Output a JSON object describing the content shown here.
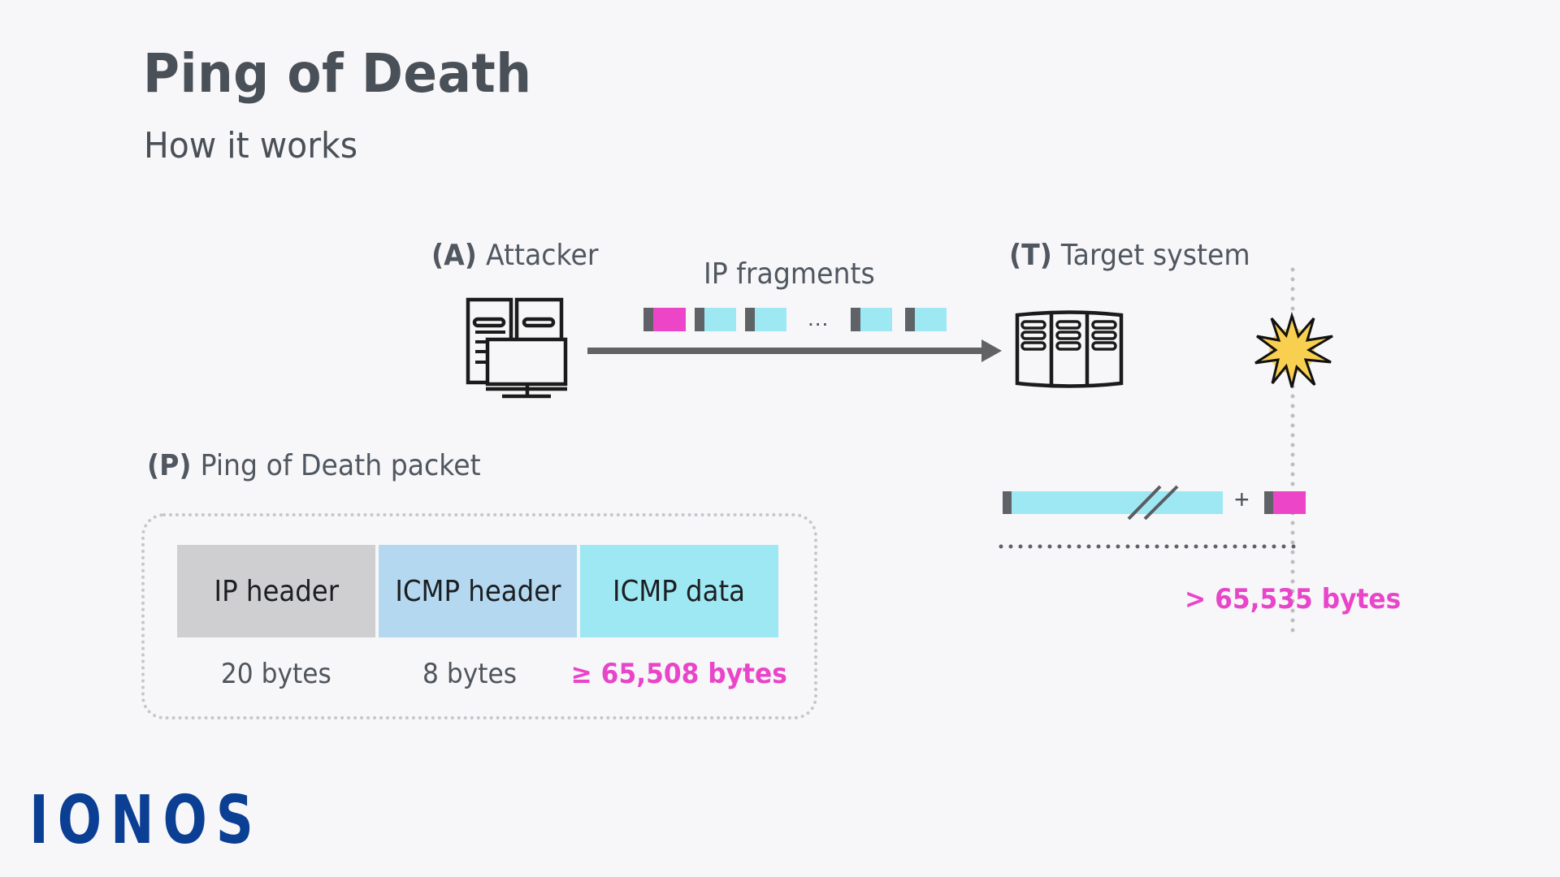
{
  "header": {
    "title": "Ping of Death",
    "subtitle": "How it works"
  },
  "attacker": {
    "tag": "(A)",
    "label": "Attacker",
    "icon": "computer-workstation-icon"
  },
  "target": {
    "tag": "(T)",
    "label": "Target system",
    "icon": "server-rack-icon",
    "event_icon": "explosion-icon"
  },
  "transfer": {
    "label": "IP fragments",
    "ellipsis": "...",
    "fragments": [
      {
        "type": "last-fragment",
        "color": "#ec45c8"
      },
      {
        "type": "fragment",
        "color": "#9ee8f4"
      },
      {
        "type": "fragment",
        "color": "#9ee8f4"
      },
      {
        "type": "fragment",
        "color": "#9ee8f4"
      },
      {
        "type": "fragment",
        "color": "#9ee8f4"
      }
    ]
  },
  "reassembly": {
    "plus": "+",
    "total_label": "> 65,535 bytes"
  },
  "packet": {
    "tag": "(P)",
    "label": "Ping of Death packet",
    "segments": [
      {
        "name": "IP header",
        "size": "20 bytes",
        "color": "#cfcfd2",
        "highlight": false
      },
      {
        "name": "ICMP header",
        "size": "8 bytes",
        "color": "#b3d8f0",
        "highlight": false
      },
      {
        "name": "ICMP data",
        "size": "≥ 65,508 bytes",
        "color": "#9ee8f4",
        "highlight": true
      }
    ]
  },
  "colors": {
    "accent_pink": "#e945c9",
    "fragment_cyan": "#9ee8f4",
    "header_dark": "#5f6367",
    "brand_blue": "#0b3f93",
    "explosion_yellow": "#fcd267"
  },
  "brand": {
    "logo_text": "IONOS"
  }
}
